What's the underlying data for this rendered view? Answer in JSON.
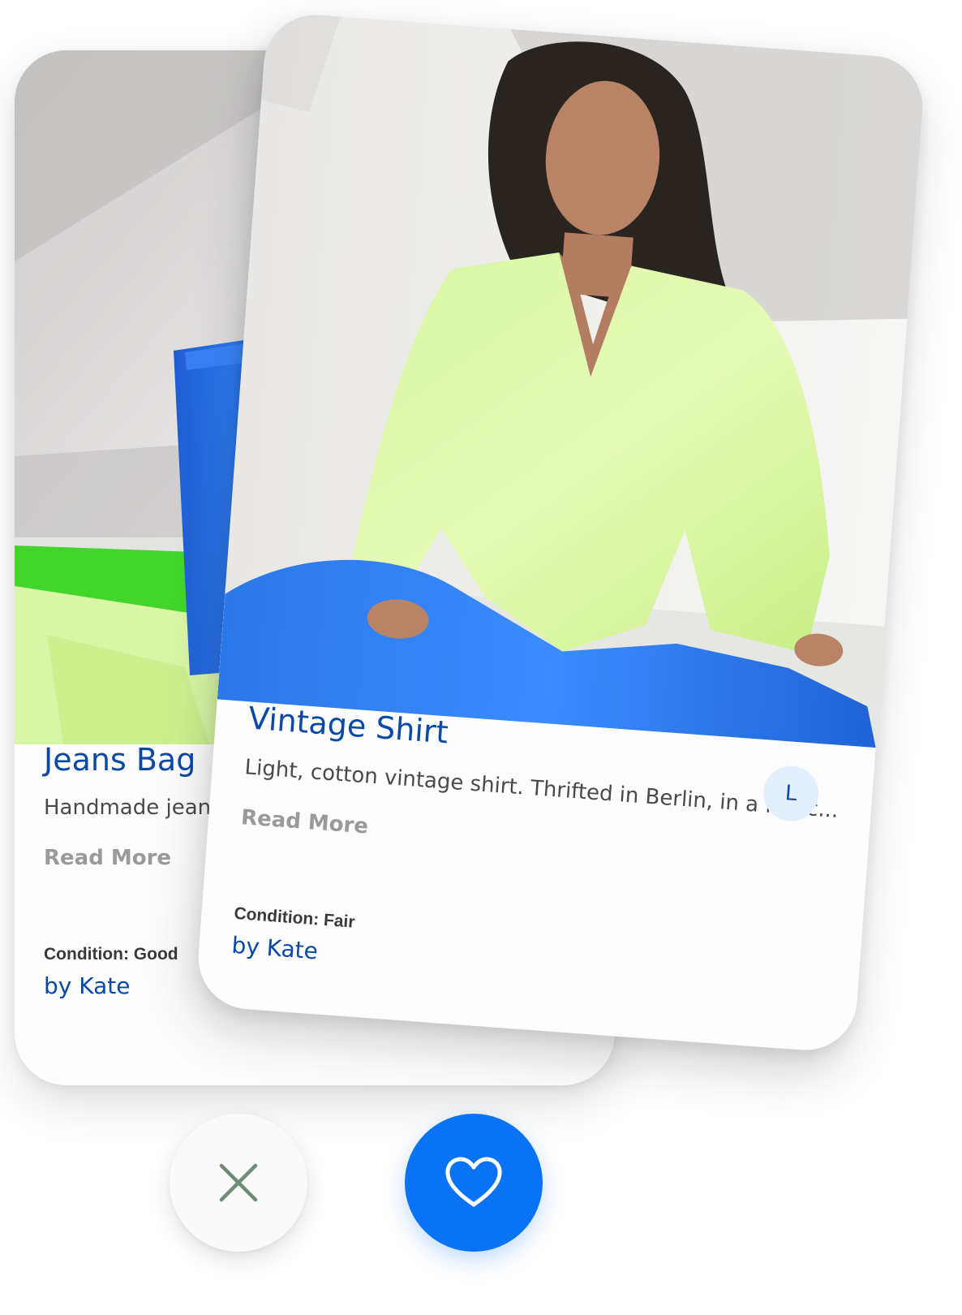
{
  "cards": {
    "back": {
      "title": "Jeans Bag",
      "description": "Handmade jeans bag",
      "read_more": "Read More",
      "condition": "Condition: Good",
      "author": "by Kate"
    },
    "front": {
      "title": "Vintage Shirt",
      "description": "Light, cotton vintage shirt. Thrifted in Berlin, in a fair c...",
      "read_more": "Read More",
      "size": "L",
      "condition": "Condition: Fair",
      "author": "by Kate"
    }
  },
  "actions": {
    "dislike_icon": "close-icon",
    "like_icon": "heart-icon"
  },
  "colors": {
    "brand_blue": "#0a49a6",
    "like_button": "#0a73f5",
    "dislike_icon": "#6f8c76",
    "size_badge_bg": "#e3efff"
  }
}
